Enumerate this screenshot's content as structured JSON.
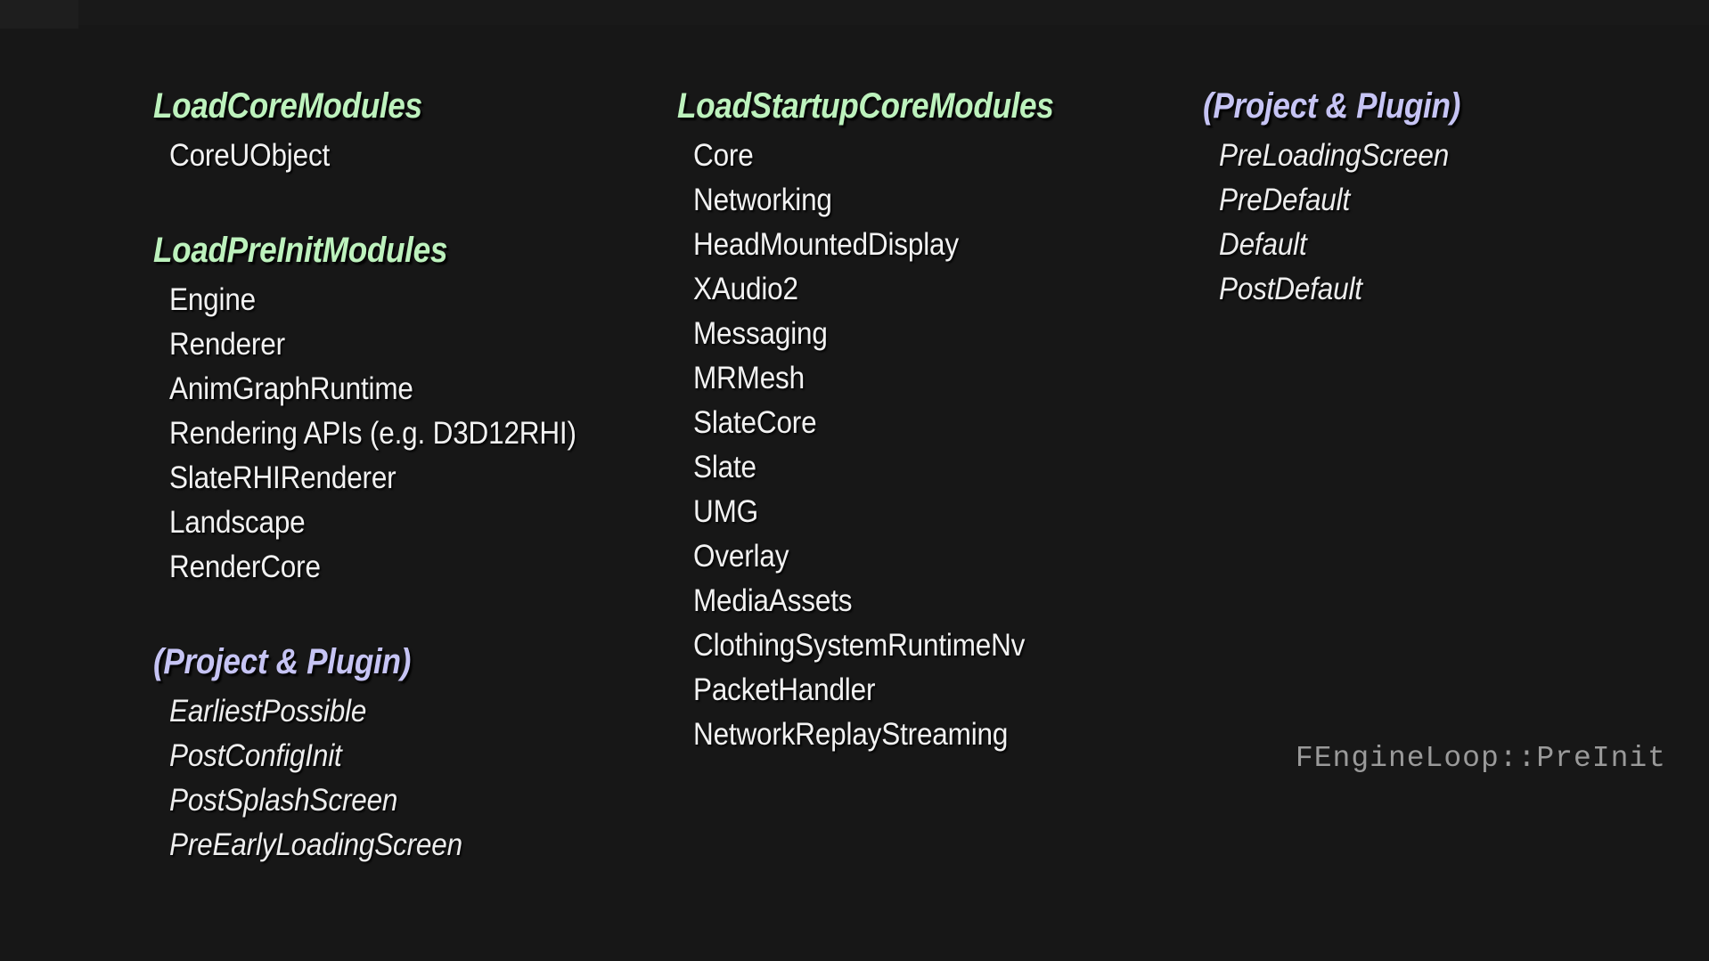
{
  "slide": {
    "background_color": "#171717",
    "heading_green": "#bdf2bd",
    "heading_purple": "#c6c4f4",
    "body_color": "#f2f2f2",
    "footnote_color": "#9a9a9a",
    "footnote": "FEngineLoop::PreInit"
  },
  "columns": [
    {
      "id": "column-left",
      "groups": [
        {
          "id": "load-core-modules",
          "title": "LoadCoreModules",
          "accent": "green",
          "italic_items": false,
          "items": [
            "CoreUObject"
          ]
        },
        {
          "id": "load-preinit-modules",
          "title": "LoadPreInitModules",
          "accent": "green",
          "italic_items": false,
          "items": [
            "Engine",
            "Renderer",
            "AnimGraphRuntime",
            "Rendering APIs (e.g. D3D12RHI)",
            "SlateRHIRenderer",
            "Landscape",
            "RenderCore"
          ]
        },
        {
          "id": "project-and-plugin-left",
          "title": "(Project & Plugin)",
          "accent": "purple",
          "italic_items": true,
          "items": [
            "EarliestPossible",
            "PostConfigInit",
            "PostSplashScreen",
            "PreEarlyLoadingScreen"
          ]
        }
      ]
    },
    {
      "id": "column-middle",
      "groups": [
        {
          "id": "load-startup-core-modules",
          "title": "LoadStartupCoreModules",
          "accent": "green",
          "italic_items": false,
          "items": [
            "Core",
            "Networking",
            "HeadMountedDisplay",
            "XAudio2",
            "Messaging",
            "MRMesh",
            "SlateCore",
            "Slate",
            "UMG",
            "Overlay",
            "MediaAssets",
            "ClothingSystemRuntimeNv",
            "PacketHandler",
            "NetworkReplayStreaming"
          ]
        }
      ]
    },
    {
      "id": "column-right",
      "groups": [
        {
          "id": "project-and-plugin-right",
          "title": "(Project & Plugin)",
          "accent": "purple",
          "italic_items": true,
          "items": [
            "PreLoadingScreen",
            "PreDefault",
            "Default",
            "PostDefault"
          ]
        }
      ]
    }
  ]
}
